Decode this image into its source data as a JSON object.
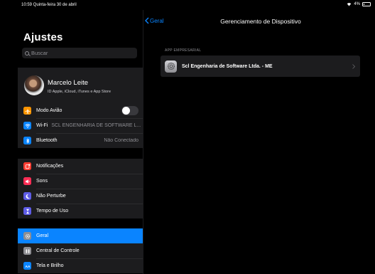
{
  "status": {
    "time_date": "10:59  Quinta-feira 30 de abril",
    "battery": "4%"
  },
  "sidebar": {
    "title": "Ajustes",
    "search_placeholder": "Buscar",
    "profile": {
      "name": "Marcelo Leite",
      "subtitle": "ID Apple, iCloud, iTunes e App Store"
    },
    "connectivity": [
      {
        "label": "Modo Avião",
        "icon": "airplane-icon",
        "color": "#ff9500",
        "toggle": false
      },
      {
        "label": "Wi-Fi",
        "detail": "SCL ENGENHARIA DE SOFTWARE L...",
        "icon": "wifi-icon",
        "color": "#0a84ff"
      },
      {
        "label": "Bluetooth",
        "detail": "Não Conectado",
        "icon": "bluetooth-icon",
        "color": "#0a84ff"
      }
    ],
    "notifications_group": [
      {
        "label": "Notificações",
        "icon": "notifications-icon",
        "color": "#ff3b30"
      },
      {
        "label": "Sons",
        "icon": "sound-icon",
        "color": "#ff2d55"
      },
      {
        "label": "Não Perturbe",
        "icon": "moon-icon",
        "color": "#5e5ce6"
      },
      {
        "label": "Tempo de Uso",
        "icon": "hourglass-icon",
        "color": "#5e5ce6"
      }
    ],
    "general_group": [
      {
        "label": "Geral",
        "icon": "gear-icon",
        "color": "#8e8e93",
        "selected": true
      },
      {
        "label": "Central de Controle",
        "icon": "control-center-icon",
        "color": "#8e8e93"
      },
      {
        "label": "Tela e Brilho",
        "icon": "display-icon",
        "color": "#0a84ff"
      }
    ]
  },
  "detail": {
    "back_label": "Geral",
    "title": "Gerenciamento de Dispositivo",
    "section_header": "APP EMPRESARIAL",
    "app_label": "Scl Engenharia de Software Ltda. - ME"
  }
}
